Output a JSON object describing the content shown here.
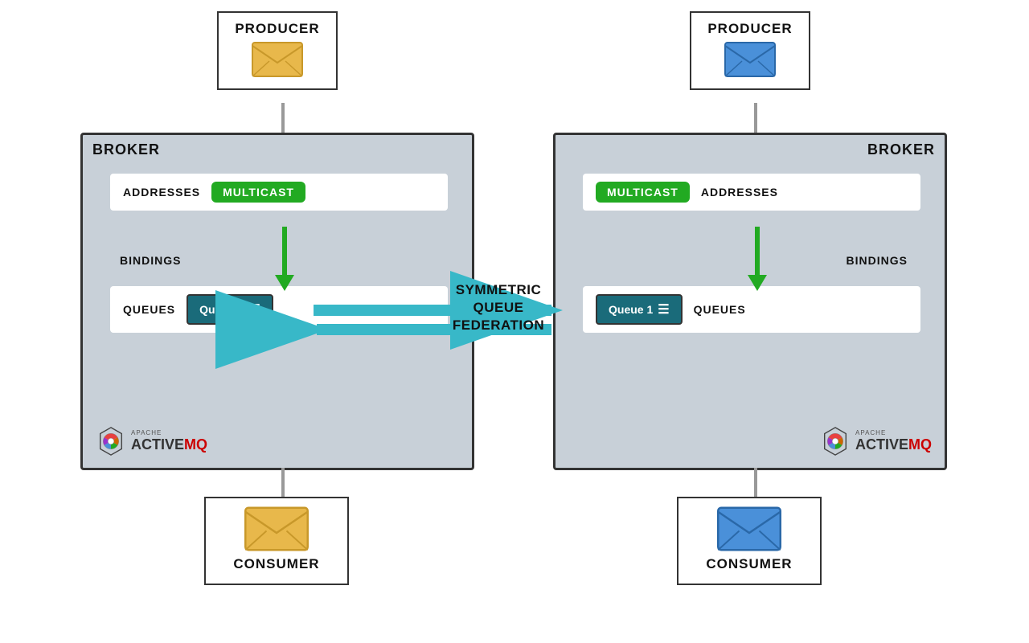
{
  "left_producer": {
    "label": "PRODUCER",
    "envelope_color": "#e8b84b"
  },
  "right_producer": {
    "label": "PRODUCER",
    "envelope_color": "#4a90d9"
  },
  "left_broker": {
    "label": "BROKER",
    "addresses_label": "ADDRESSES",
    "multicast_label": "MULTICAST",
    "bindings_label": "BINDINGS",
    "queues_label": "QUEUES",
    "queue_name": "Queue 1"
  },
  "right_broker": {
    "label": "BROKER",
    "addresses_label": "ADDRESSES",
    "multicast_label": "MULTICAST",
    "bindings_label": "BINDINGS",
    "queues_label": "QUEUES",
    "queue_name": "Queue 1"
  },
  "federation": {
    "label": "SYMMETRIC\nQUEUE\nFEDERATION"
  },
  "left_consumer": {
    "label": "CONSUMER",
    "envelope_color": "#e8b84b"
  },
  "right_consumer": {
    "label": "CONSUMER",
    "envelope_color": "#4a90d9"
  },
  "activemq": {
    "apache_label": "APACHE",
    "name_label": "ACTIVE",
    "mq_label": "MQ"
  }
}
